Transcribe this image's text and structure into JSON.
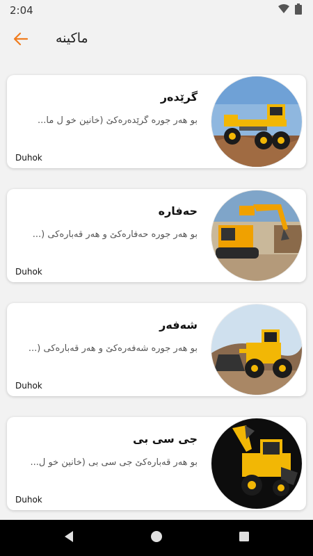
{
  "status": {
    "time": "2:04"
  },
  "header": {
    "title": "ماکینە"
  },
  "accent_color": "#f07c1e",
  "items": [
    {
      "title": "گرێدەر",
      "description": "بو هەر جورە گرێدەرەکێ  (خانین خو ل ما...",
      "city": "Duhok"
    },
    {
      "title": "حەفارە",
      "description": "بو هەر جورە حەفارەکێ و هەر قەبارەکی  (...",
      "city": "Duhok"
    },
    {
      "title": "شەفەر",
      "description": "بو هەر جورە شەفەرەکێ و هەر قەبارەکی  (...",
      "city": "Duhok"
    },
    {
      "title": "جی سی بی",
      "description": "بو هەر قەبارەکێ جی سی بی  (خانین خو ل...",
      "city": "Duhok"
    }
  ]
}
